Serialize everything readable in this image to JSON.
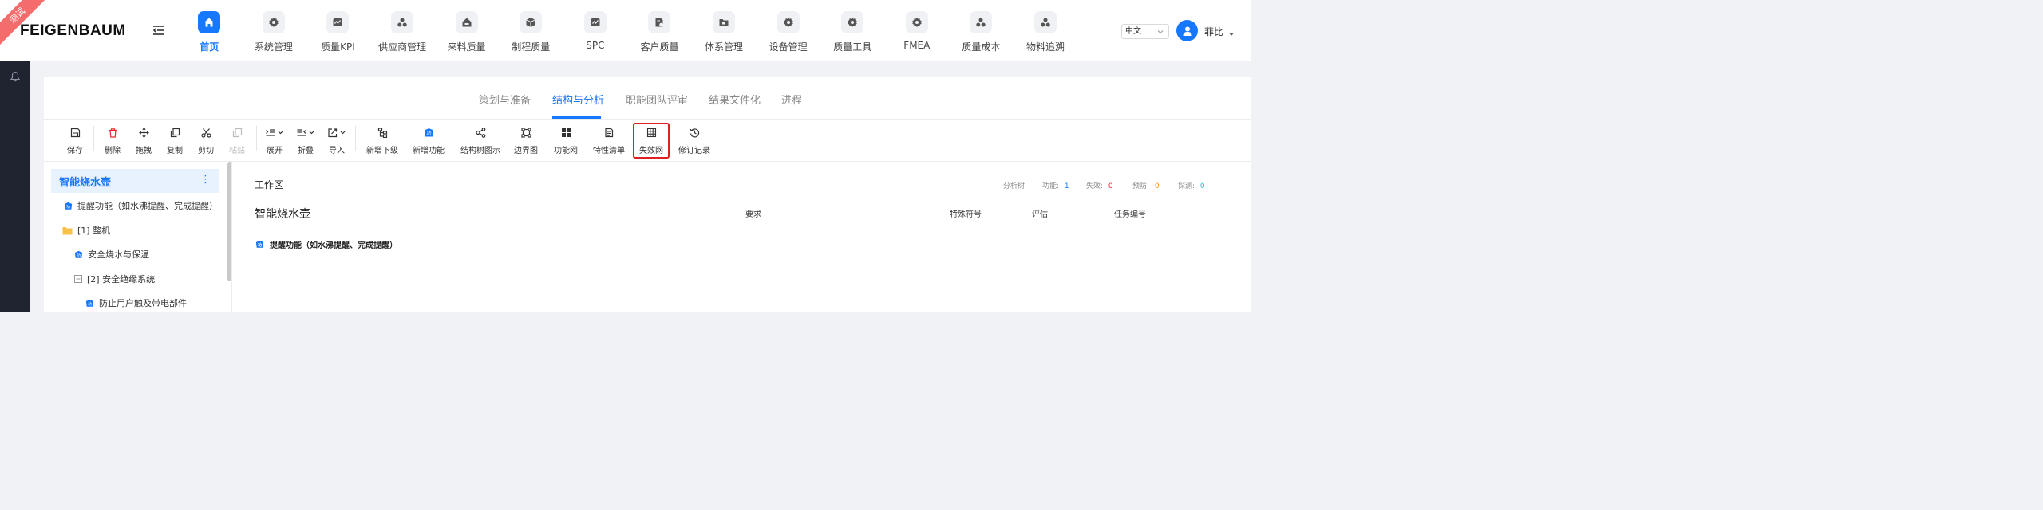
{
  "ribbon": "测试",
  "brand": "FEIGENBAUM",
  "nav": [
    {
      "label": "首页",
      "icon": "home-icon",
      "active": true
    },
    {
      "label": "系统管理",
      "icon": "gear-icon"
    },
    {
      "label": "质量KPI",
      "icon": "chart-icon"
    },
    {
      "label": "供应商管理",
      "icon": "cluster-icon"
    },
    {
      "label": "来料质量",
      "icon": "inbox-icon"
    },
    {
      "label": "制程质量",
      "icon": "box-icon"
    },
    {
      "label": "SPC",
      "icon": "chart-icon"
    },
    {
      "label": "客户质量",
      "icon": "doc-icon"
    },
    {
      "label": "体系管理",
      "icon": "folder-icon"
    },
    {
      "label": "设备管理",
      "icon": "gear-icon"
    },
    {
      "label": "质量工具",
      "icon": "gear-icon"
    },
    {
      "label": "FMEA",
      "icon": "gear-icon"
    },
    {
      "label": "质量成本",
      "icon": "cluster-icon"
    },
    {
      "label": "物料追溯",
      "icon": "cluster-icon"
    }
  ],
  "language": "中文",
  "user": {
    "name": "菲比"
  },
  "tabs": [
    {
      "label": "策划与准备"
    },
    {
      "label": "结构与分析",
      "active": true
    },
    {
      "label": "职能团队评审"
    },
    {
      "label": "结果文件化"
    },
    {
      "label": "进程"
    }
  ],
  "toolbar": [
    {
      "label": "保存",
      "icon": "save-icon"
    },
    {
      "label": "删除",
      "icon": "trash-icon",
      "color": "#f5222d"
    },
    {
      "label": "拖拽",
      "icon": "move-icon"
    },
    {
      "label": "复制",
      "icon": "copy-icon"
    },
    {
      "label": "剪切",
      "icon": "scissors-icon"
    },
    {
      "label": "粘贴",
      "icon": "paste-icon",
      "disabled": true
    },
    {
      "label": "展开",
      "icon": "expand-icon"
    },
    {
      "label": "折叠",
      "icon": "collapse-icon"
    },
    {
      "label": "导入",
      "icon": "import-icon"
    },
    {
      "label": "新增下级",
      "icon": "add-child-icon"
    },
    {
      "label": "新增功能",
      "icon": "function-icon"
    },
    {
      "label": "结构树图示",
      "icon": "share-icon"
    },
    {
      "label": "边界图",
      "icon": "boundary-icon"
    },
    {
      "label": "功能网",
      "icon": "grid-icon"
    },
    {
      "label": "特性清单",
      "icon": "list-icon"
    },
    {
      "label": "失效网",
      "icon": "table-icon",
      "highlighted": true
    },
    {
      "label": "修订记录",
      "icon": "history-icon"
    }
  ],
  "tree": {
    "root": "智能烧水壶",
    "nodes": [
      {
        "label": "提醒功能（如水沸提醒、完成提醒）",
        "icon": "function-icon"
      },
      {
        "label": "[1] 整机",
        "icon": "folder-icon"
      },
      {
        "label": "安全烧水与保温",
        "icon": "function-icon"
      },
      {
        "label": "[2] 安全绝缘系统",
        "icon": "collapse-box-icon"
      },
      {
        "label": "防止用户触及带电部件",
        "icon": "function-icon"
      }
    ]
  },
  "workspace": {
    "title": "工作区",
    "stats": {
      "tree_label": "分析树",
      "function_label": "功能:",
      "function_value": "1",
      "failure_label": "失效:",
      "failure_value": "0",
      "prevention_label": "预防:",
      "prevention_value": "0",
      "detection_label": "探测:",
      "detection_value": "0"
    },
    "heading": "智能烧水壶",
    "columns": {
      "requirement": "要求",
      "special_symbol": "特殊符号",
      "evaluation": "评估",
      "task_no": "任务编号"
    },
    "rows": [
      {
        "label": "提醒功能（如水沸提醒、完成提醒）"
      }
    ]
  },
  "colors": {
    "primary": "#1677ff",
    "danger": "#f5222d",
    "failure": "#f5222d",
    "prevention": "#fa8c16",
    "detection": "#13c2c2"
  }
}
